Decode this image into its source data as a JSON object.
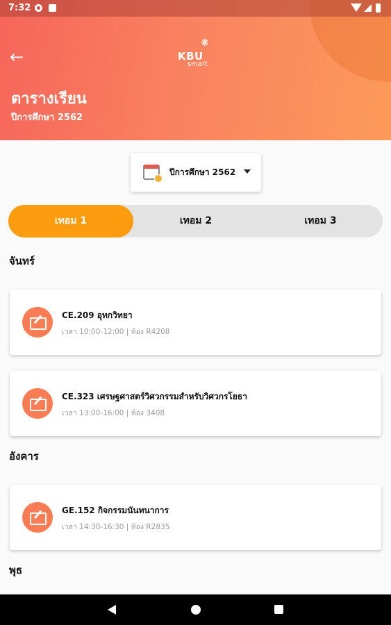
{
  "status_bar": {
    "time": "7:32"
  },
  "header": {
    "logo_main": "KBU",
    "logo_sub": "smart",
    "title": "ตารางเรียน",
    "subtitle": "ปีการศึกษา 2562"
  },
  "year_selector": {
    "label": "ปีการศึกษา 2562"
  },
  "tabs": [
    {
      "label": "เทอม 1",
      "active": true
    },
    {
      "label": "เทอม 2",
      "active": false
    },
    {
      "label": "เทอม 3",
      "active": false
    }
  ],
  "days": [
    {
      "name": "จันทร์",
      "courses": [
        {
          "name": "CE.209 อุทกวิทยา",
          "meta": "เวลา 10:00-12:00 | ห้อง R4208"
        },
        {
          "name": "CE.323 เศรษฐศาสตร์วิศวกรรมสำหรับวิศวกรโยธา",
          "meta": "เวลา 13:00-16:00 | ห้อง 3408"
        }
      ]
    },
    {
      "name": "อังคาร",
      "courses": [
        {
          "name": "GE.152 กิจกรรมนันทนาการ",
          "meta": "เวลา 14:30-16:30 | ห้อง R2835"
        }
      ]
    },
    {
      "name": "พุธ",
      "courses": []
    }
  ],
  "colors": {
    "accent": "#fd9c0e",
    "header_start": "#f6655a",
    "header_end": "#fd9a5a",
    "icon_bg": "#f97c54"
  }
}
